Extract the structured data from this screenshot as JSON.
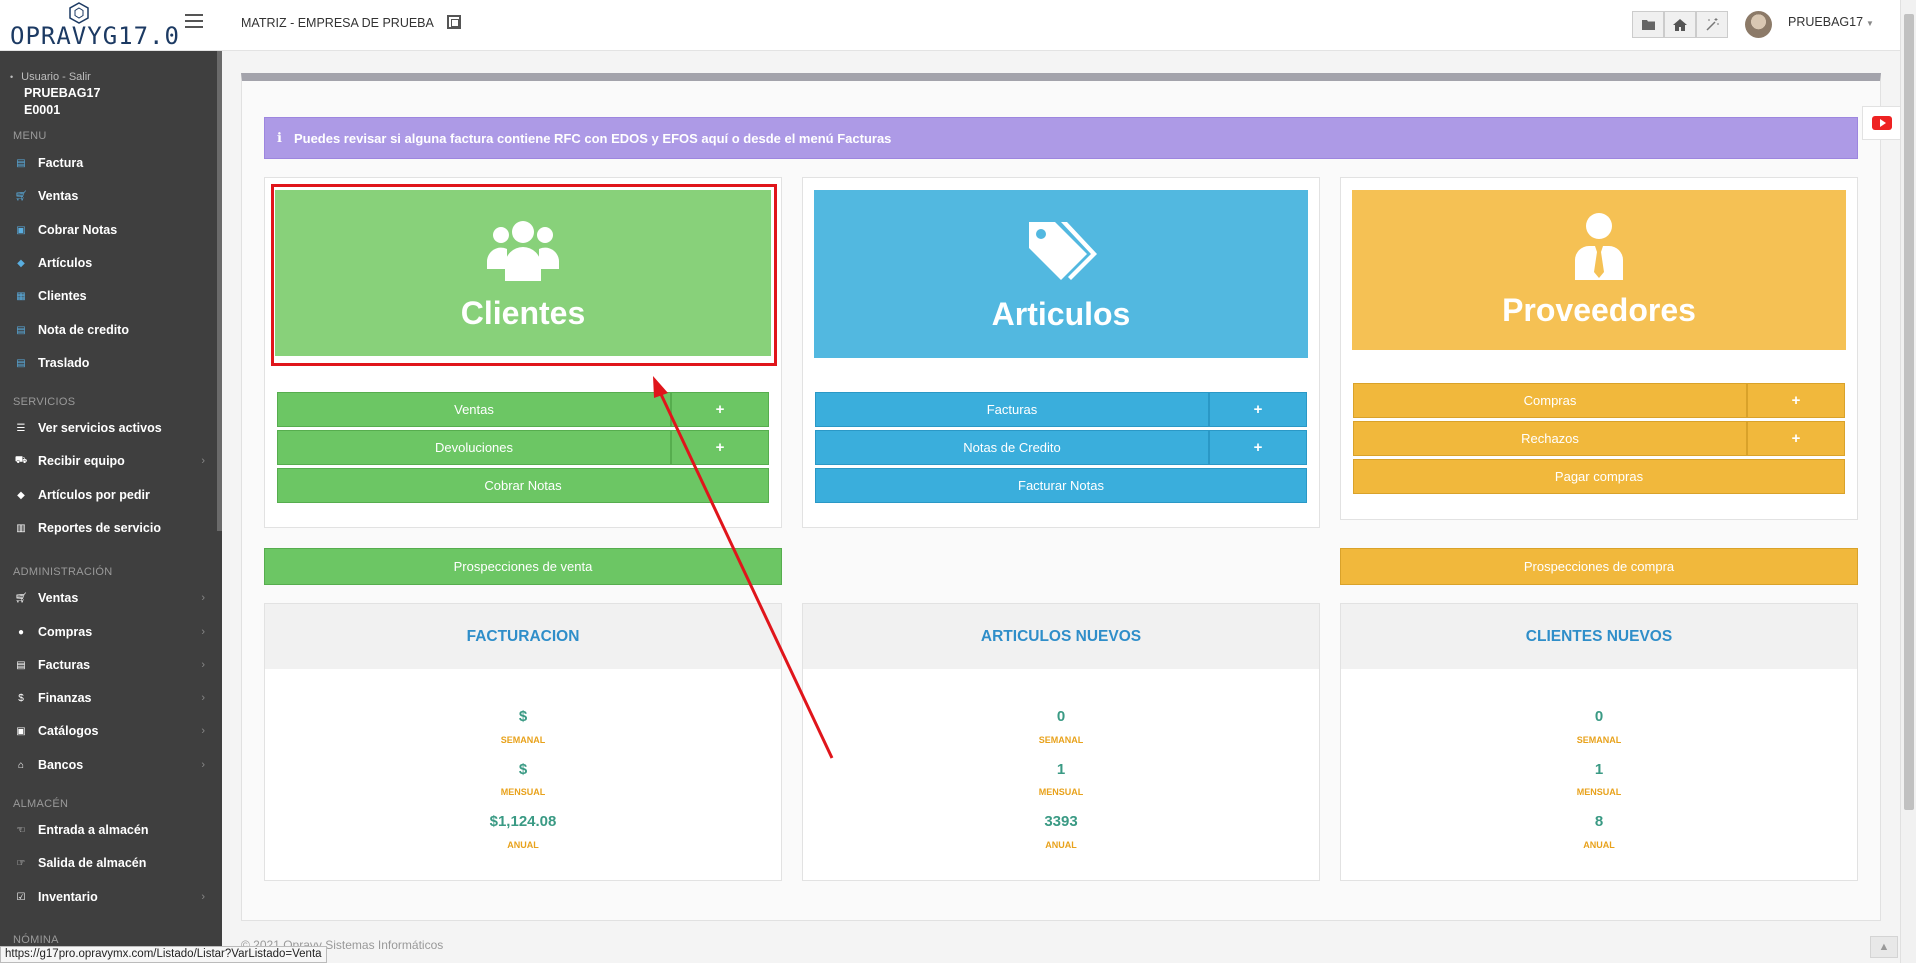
{
  "header": {
    "logo_text": "OPRAVYG17.0",
    "company": "MATRIZ - EMPRESA DE PRUEBA",
    "user": "PRUEBAG17",
    "toolbar_icons": [
      "folder-icon",
      "home-icon",
      "magic-wand-icon"
    ]
  },
  "sidebar": {
    "user_link": "Usuario - Salir",
    "user_name": "PRUEBAG17",
    "user_code": "E0001",
    "sections": {
      "menu": "MENU",
      "servicios": "SERVICIOS",
      "administracion": "ADMINISTRACIÓN",
      "almacen": "ALMACÉN",
      "nomina": "NÓMINA"
    },
    "menu_items": [
      {
        "label": "Factura",
        "icon": "invoice-icon"
      },
      {
        "label": "Ventas",
        "icon": "cart-icon"
      },
      {
        "label": "Cobrar Notas",
        "icon": "money-icon"
      },
      {
        "label": "Artículos",
        "icon": "tag-icon"
      },
      {
        "label": "Clientes",
        "icon": "contacts-icon"
      },
      {
        "label": "Nota de credito",
        "icon": "document-icon"
      },
      {
        "label": "Traslado",
        "icon": "document-icon"
      }
    ],
    "servicios_items": [
      {
        "label": "Ver servicios activos",
        "icon": "list-icon"
      },
      {
        "label": "Recibir equipo",
        "icon": "truck-icon"
      },
      {
        "label": "Artículos por pedir",
        "icon": "tag-icon"
      },
      {
        "label": "Reportes de servicio",
        "icon": "bar-chart-icon"
      }
    ],
    "administracion_items": [
      {
        "label": "Ventas",
        "icon": "cart-icon"
      },
      {
        "label": "Compras",
        "icon": "circle-icon"
      },
      {
        "label": "Facturas",
        "icon": "invoice-icon"
      },
      {
        "label": "Finanzas",
        "icon": "dollar-icon"
      },
      {
        "label": "Catálogos",
        "icon": "book-icon"
      },
      {
        "label": "Bancos",
        "icon": "bank-icon"
      }
    ],
    "almacen_items": [
      {
        "label": "Entrada a almacén",
        "icon": "hand-in-icon"
      },
      {
        "label": "Salida de almacén",
        "icon": "hand-out-icon"
      },
      {
        "label": "Inventario",
        "icon": "checklist-icon"
      }
    ]
  },
  "info_message": "Puedes revisar si alguna factura contiene RFC con EDOS y EFOS aquí o desde el menú Facturas",
  "cards": {
    "clientes": {
      "title": "Clientes",
      "buttons": [
        "Ventas",
        "Devoluciones",
        "Cobrar Notas"
      ],
      "plus": "+"
    },
    "articulos": {
      "title": "Articulos",
      "buttons": [
        "Facturas",
        "Notas de Credito",
        "Facturar Notas"
      ],
      "plus": "+"
    },
    "proveedores": {
      "title": "Proveedores",
      "buttons": [
        "Compras",
        "Rechazos",
        "Pagar compras"
      ],
      "plus": "+"
    }
  },
  "prospecciones": {
    "venta": "Prospecciones de venta",
    "compra": "Prospecciones de compra"
  },
  "stats": {
    "labels": {
      "semanal": "SEMANAL",
      "mensual": "MENSUAL",
      "anual": "ANUAL"
    },
    "facturacion": {
      "title": "FACTURACION",
      "semanal": "$",
      "mensual": "$",
      "anual": "$1,124.08"
    },
    "articulos_nuevos": {
      "title": "ARTICULOS NUEVOS",
      "semanal": "0",
      "mensual": "1",
      "anual": "3393"
    },
    "clientes_nuevos": {
      "title": "CLIENTES NUEVOS",
      "semanal": "0",
      "mensual": "1",
      "anual": "8"
    }
  },
  "footer": "© 2021 Opravy Sistemas Informáticos",
  "status_url": "https://g17pro.opravymx.com/Listado/Listar?VarListado=Venta",
  "colors": {
    "green": "#6cc664",
    "blue": "#3aaedc",
    "orange": "#f1b83c",
    "purple": "#ad9ae6",
    "annotation_red": "#e0151b"
  }
}
